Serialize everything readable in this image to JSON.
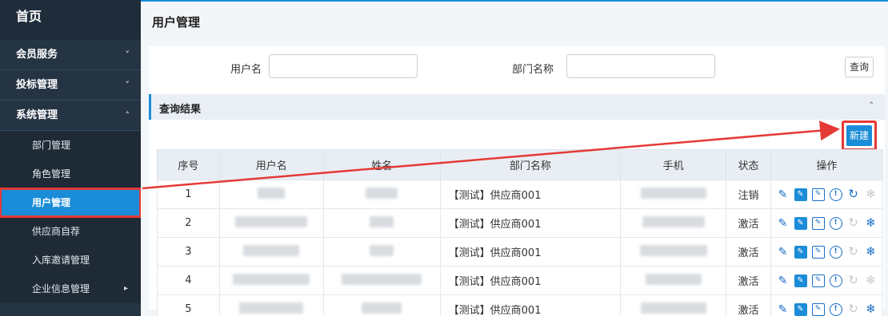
{
  "sidebar": {
    "home": "首页",
    "groups": [
      {
        "label": "会员服务",
        "chevron": "˅"
      },
      {
        "label": "投标管理",
        "chevron": "˅"
      },
      {
        "label": "系统管理",
        "chevron": "˄"
      }
    ],
    "items": [
      {
        "label": "部门管理"
      },
      {
        "label": "角色管理"
      },
      {
        "label": "用户管理"
      },
      {
        "label": "供应商自荐"
      },
      {
        "label": "入库邀请管理"
      },
      {
        "label": "企业信息管理",
        "chevron": "▸"
      }
    ]
  },
  "page": {
    "title": "用户管理"
  },
  "search": {
    "username_label": "用户名",
    "username_value": "",
    "dept_label": "部门名称",
    "dept_value": "",
    "query_button": "查询"
  },
  "results": {
    "title": "查询结果",
    "collapse_icon": "˄",
    "new_button": "新建"
  },
  "table": {
    "headers": [
      "序号",
      "用户名",
      "姓名",
      "部门名称",
      "手机",
      "状态",
      "操作"
    ],
    "rows": [
      {
        "no": "1",
        "dept": "【测试】供应商001",
        "status": "注销"
      },
      {
        "no": "2",
        "dept": "【测试】供应商001",
        "status": "激活"
      },
      {
        "no": "3",
        "dept": "【测试】供应商001",
        "status": "激活"
      },
      {
        "no": "4",
        "dept": "【测试】供应商001",
        "status": "激活"
      },
      {
        "no": "5",
        "dept": "【测试】供应商001",
        "status": "激活"
      }
    ]
  },
  "icons": {
    "pencil": "pencil-icon",
    "edit": "edit-square-icon",
    "info": "info-circle-icon",
    "refresh": "refresh-icon",
    "snowflake": "snowflake-icon"
  },
  "colors": {
    "accent": "#1a8cd8",
    "highlight": "#e53935",
    "sidebar": "#253443"
  }
}
